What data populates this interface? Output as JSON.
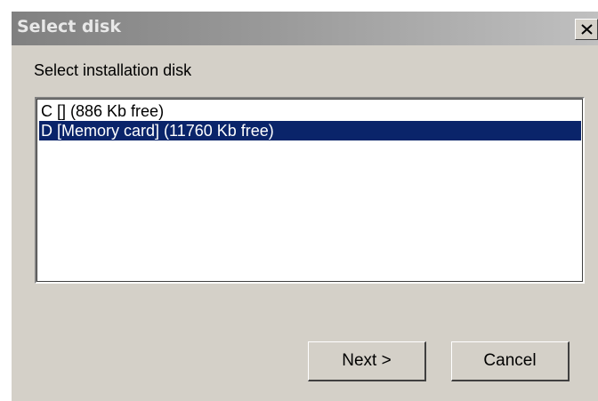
{
  "window": {
    "title": "Select disk",
    "close_icon": "close-icon"
  },
  "dialog": {
    "instruction": "Select installation disk",
    "disks": [
      {
        "label": "C [] (886 Kb free)",
        "selected": false
      },
      {
        "label": "D [Memory card] (11760 Kb free)",
        "selected": true
      }
    ],
    "buttons": {
      "next": "Next >",
      "cancel": "Cancel"
    }
  },
  "colors": {
    "dialog_bg": "#d4d0c8",
    "selection_bg": "#0a246a",
    "selection_text": "#ffffff",
    "titlebar_gradient_start": "#808080",
    "titlebar_gradient_end": "#c0c0c0"
  }
}
